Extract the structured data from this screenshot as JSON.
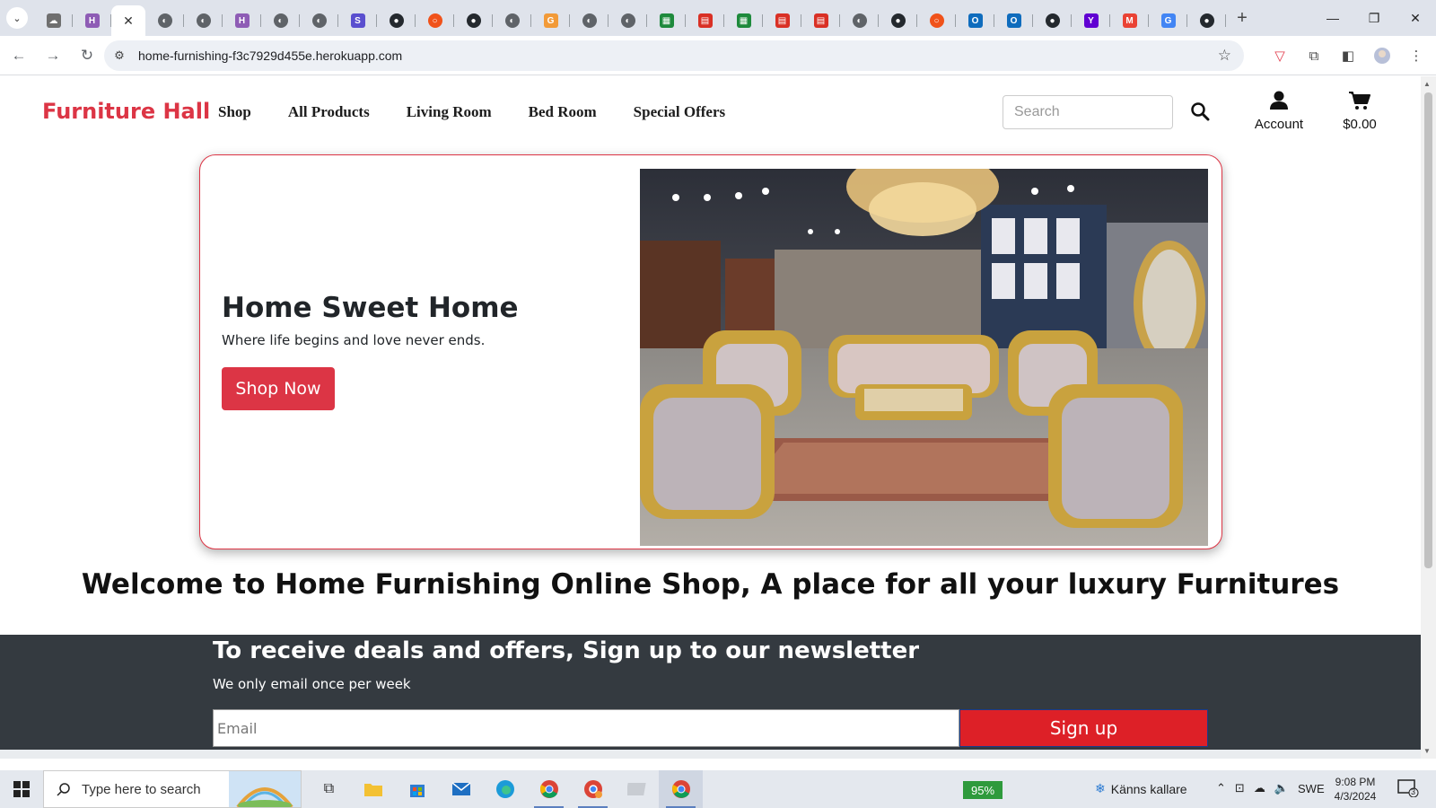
{
  "browser": {
    "tabs": [
      {
        "icon": "cloud-favicon",
        "color": "#6f6f6f",
        "glyph": "☁"
      },
      {
        "icon": "h-favicon",
        "color": "#8e5cb5",
        "glyph": "H"
      },
      {
        "icon": "page-favicon",
        "color": "#ffffff",
        "glyph": "",
        "active": true
      },
      {
        "icon": "globe-favicon",
        "color": "#5f6368",
        "glyph": "◐"
      },
      {
        "icon": "globe-favicon",
        "color": "#5f6368",
        "glyph": "◐"
      },
      {
        "icon": "h-favicon",
        "color": "#8e5cb5",
        "glyph": "H"
      },
      {
        "icon": "globe-favicon",
        "color": "#5f6368",
        "glyph": "◐"
      },
      {
        "icon": "globe-favicon",
        "color": "#5f6368",
        "glyph": "◐"
      },
      {
        "icon": "s-favicon",
        "color": "#5a4fcf",
        "glyph": "S"
      },
      {
        "icon": "github-favicon",
        "color": "#24292e",
        "glyph": "●"
      },
      {
        "icon": "ring-favicon",
        "color": "#f0521a",
        "glyph": "○"
      },
      {
        "icon": "github-favicon",
        "color": "#24292e",
        "glyph": "●"
      },
      {
        "icon": "globe-favicon",
        "color": "#5f6368",
        "glyph": "◐"
      },
      {
        "icon": "g-favicon",
        "color": "#f29a38",
        "glyph": "G"
      },
      {
        "icon": "globe-favicon",
        "color": "#5f6368",
        "glyph": "◐"
      },
      {
        "icon": "globe-favicon",
        "color": "#5f6368",
        "glyph": "◐"
      },
      {
        "icon": "sheet-favicon",
        "color": "#1e8a3c",
        "glyph": "▦"
      },
      {
        "icon": "pdf-favicon",
        "color": "#d93025",
        "glyph": "▤"
      },
      {
        "icon": "sheet-favicon",
        "color": "#1e8a3c",
        "glyph": "▦"
      },
      {
        "icon": "pdf-favicon",
        "color": "#d93025",
        "glyph": "▤"
      },
      {
        "icon": "pdf-favicon",
        "color": "#d93025",
        "glyph": "▤"
      },
      {
        "icon": "globe-favicon",
        "color": "#5f6368",
        "glyph": "◐"
      },
      {
        "icon": "github-favicon",
        "color": "#24292e",
        "glyph": "●"
      },
      {
        "icon": "ring-favicon",
        "color": "#f0521a",
        "glyph": "○"
      },
      {
        "icon": "outlook-favicon",
        "color": "#0f6cbd",
        "glyph": "O"
      },
      {
        "icon": "outlook-favicon",
        "color": "#0f6cbd",
        "glyph": "O"
      },
      {
        "icon": "github-favicon",
        "color": "#24292e",
        "glyph": "●"
      },
      {
        "icon": "yahoo-favicon",
        "color": "#6001d2",
        "glyph": "Y"
      },
      {
        "icon": "gmail-favicon",
        "color": "#ea4335",
        "glyph": "M"
      },
      {
        "icon": "google-favicon",
        "color": "#4285f4",
        "glyph": "G"
      },
      {
        "icon": "github-favicon",
        "color": "#24292e",
        "glyph": "●"
      }
    ],
    "url": "home-furnishing-f3c7929d455e.herokuapp.com"
  },
  "site": {
    "brand": "Furniture Hall",
    "brand_color": "#dc3545",
    "menu": [
      "Shop",
      "All Products",
      "Living Room",
      "Bed Room",
      "Special Offers"
    ],
    "search_placeholder": "Search",
    "account_label": "Account",
    "cart_total": "$0.00"
  },
  "hero": {
    "title": "Home Sweet Home",
    "subtitle": "Where life begins and love never ends.",
    "button": "Shop Now"
  },
  "welcome": "Welcome to Home Furnishing Online Shop, A place for all your luxury Furnitures",
  "newsletter": {
    "title": "To receive deals and offers, Sign up to our newsletter",
    "subtitle": "We only email once per week",
    "email_placeholder": "Email",
    "button": "Sign up",
    "background": "#343a40",
    "button_color": "#dd2027"
  },
  "taskbar": {
    "search_placeholder": "Type here to search",
    "battery": "95%",
    "weather": "Känns kallare",
    "language": "SWE",
    "time": "9:08 PM",
    "date": "4/3/2024",
    "notifications": "3"
  }
}
